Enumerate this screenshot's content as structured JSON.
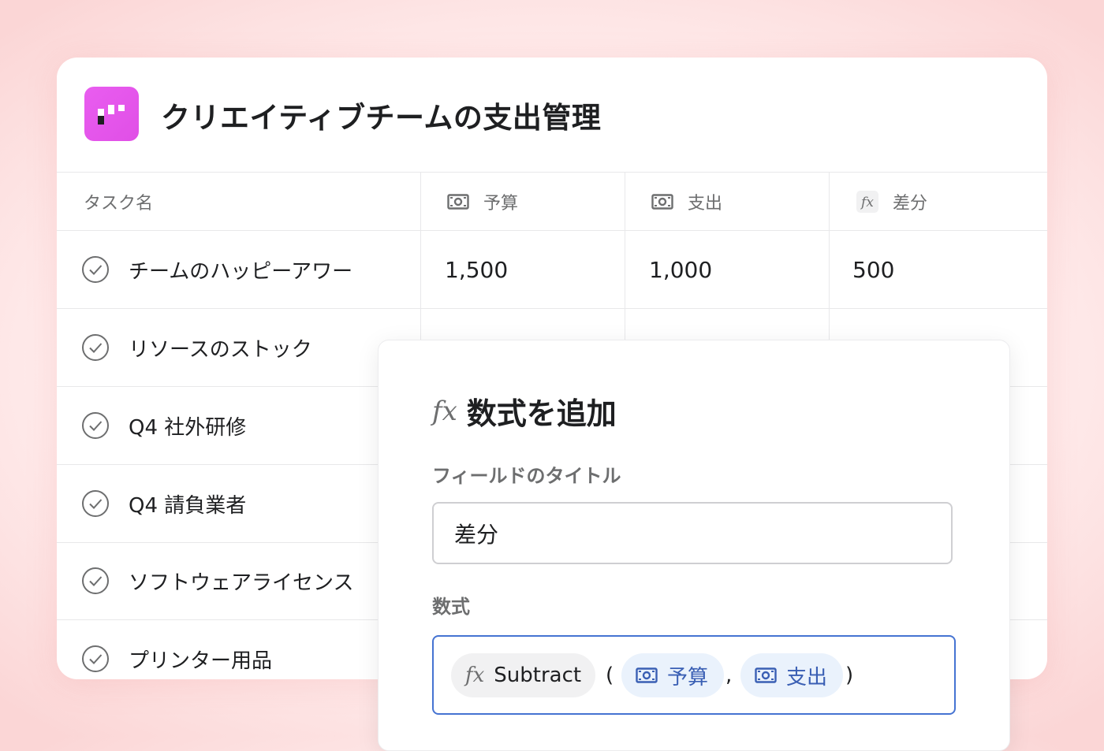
{
  "app": {
    "title": "クリエイティブチームの支出管理",
    "icon": "app-logo-icon",
    "accent_color": "#e358ea"
  },
  "table": {
    "columns": [
      {
        "label": "タスク名",
        "icon": null
      },
      {
        "label": "予算",
        "icon": "money-icon"
      },
      {
        "label": "支出",
        "icon": "money-icon"
      },
      {
        "label": "差分",
        "icon": "formula-fx-icon"
      }
    ],
    "rows": [
      {
        "name": "チームのハッピーアワー",
        "budget": "1,500",
        "spend": "1,000",
        "diff": "500"
      },
      {
        "name": "リソースのストック"
      },
      {
        "name": "Q4 社外研修"
      },
      {
        "name": "Q4 請負業者"
      },
      {
        "name": "ソフトウェアライセンス"
      },
      {
        "name": "プリンター用品"
      }
    ]
  },
  "dialog": {
    "title": "数式を追加",
    "title_icon": "fx",
    "field_title_label": "フィールドのタイトル",
    "field_title_value": "差分",
    "formula_label": "数式",
    "formula": {
      "fx_glyph": "fx",
      "function": "Subtract",
      "open_paren": "(",
      "separator": ",",
      "close_paren": ")",
      "args": [
        "予算",
        "支出"
      ]
    },
    "focus_color": "#4573d2",
    "chip_color": "#eaf2fc"
  }
}
